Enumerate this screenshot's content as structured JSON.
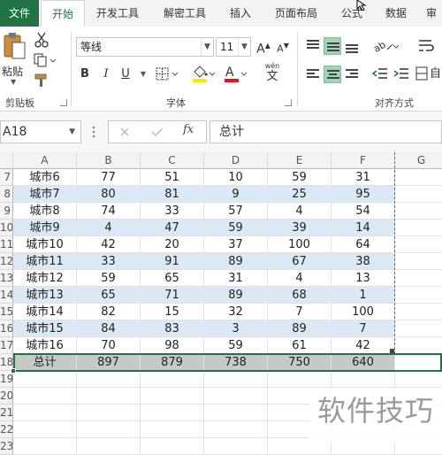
{
  "tabs": [
    {
      "label": "文件",
      "active": false
    },
    {
      "label": "开始",
      "active": true
    },
    {
      "label": "开发工具",
      "active": false
    },
    {
      "label": "解密工具",
      "active": false
    },
    {
      "label": "插入",
      "active": false
    },
    {
      "label": "页面布局",
      "active": false
    },
    {
      "label": "公式",
      "active": false
    },
    {
      "label": "数据",
      "active": false
    },
    {
      "label": "审",
      "active": false
    }
  ],
  "ribbon": {
    "paste_label": "粘贴",
    "clipboard_label": "剪贴板",
    "font_name": "等线",
    "font_size": "11",
    "font_group_label": "字体",
    "align_group_label": "对齐方式",
    "bold": "B",
    "italic": "I",
    "underline": "U",
    "increase_font": "A",
    "decrease_font": "A",
    "phonetic_top": "wén",
    "phonetic_char": "文",
    "wrap_label": "自"
  },
  "colors": {
    "brand": "#217346",
    "fill_color": "#ffe600",
    "font_color": "#e81123",
    "band": "#dbe9f6",
    "total_row": "#c8c8c8",
    "selection_border": "#217346"
  },
  "formula_bar": {
    "name_box": "A18",
    "fx_label": "fx",
    "content": "总计",
    "cancel_icon": "x-icon",
    "enter_icon": "check-icon"
  },
  "columns": [
    "A",
    "B",
    "C",
    "D",
    "E",
    "F",
    "G"
  ],
  "rows": [
    {
      "num": "7",
      "cells": [
        "城市6",
        "77",
        "51",
        "10",
        "59",
        "31"
      ],
      "band": false
    },
    {
      "num": "8",
      "cells": [
        "城市7",
        "80",
        "81",
        "9",
        "25",
        "95"
      ],
      "band": true
    },
    {
      "num": "9",
      "cells": [
        "城市8",
        "74",
        "33",
        "57",
        "4",
        "54"
      ],
      "band": false
    },
    {
      "num": "10",
      "cells": [
        "城市9",
        "4",
        "47",
        "59",
        "39",
        "14"
      ],
      "band": true
    },
    {
      "num": "11",
      "cells": [
        "城市10",
        "42",
        "20",
        "37",
        "100",
        "64"
      ],
      "band": false
    },
    {
      "num": "12",
      "cells": [
        "城市11",
        "33",
        "91",
        "89",
        "67",
        "38"
      ],
      "band": true
    },
    {
      "num": "13",
      "cells": [
        "城市12",
        "59",
        "65",
        "31",
        "4",
        "13"
      ],
      "band": false
    },
    {
      "num": "14",
      "cells": [
        "城市13",
        "65",
        "71",
        "89",
        "68",
        "1"
      ],
      "band": true
    },
    {
      "num": "15",
      "cells": [
        "城市14",
        "82",
        "15",
        "32",
        "7",
        "100"
      ],
      "band": false
    },
    {
      "num": "16",
      "cells": [
        "城市15",
        "84",
        "83",
        "3",
        "89",
        "7"
      ],
      "band": true
    },
    {
      "num": "17",
      "cells": [
        "城市16",
        "70",
        "98",
        "59",
        "61",
        "42"
      ],
      "band": false
    }
  ],
  "total_row": {
    "num": "18",
    "cells": [
      "总计",
      "897",
      "879",
      "738",
      "750",
      "640"
    ]
  },
  "empty_rows": [
    "19",
    "20",
    "21",
    "22",
    "23"
  ],
  "watermark": "软件技巧"
}
